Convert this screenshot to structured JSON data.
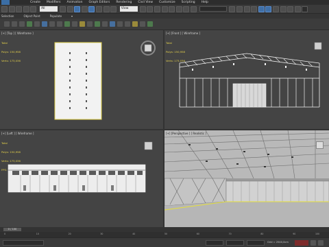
{
  "menu": {
    "items": [
      "Create",
      "Modifiers",
      "Animation",
      "Graph Editors",
      "Rendering",
      "Civil View",
      "Customize",
      "Scripting",
      "Help"
    ]
  },
  "toolbar": {
    "filter_value": "All",
    "view_value": "View"
  },
  "ribbon": {
    "tabs": [
      "Selection",
      "Object Paint",
      "Populate"
    ]
  },
  "viewports": {
    "top": {
      "label": "[+] [Top ] [ Wireframe ]",
      "stats_total": "Total",
      "stats_polys": "Polys: 150,958",
      "stats_verts": "Verts: 173,036"
    },
    "front": {
      "label": "[+] [Front ] [ Wireframe ]",
      "stats_total": "Total",
      "stats_polys": "Polys: 150,958",
      "stats_verts": "Verts: 173,036"
    },
    "left": {
      "label": "[+] [Left ] [ Wireframe ]",
      "stats_total": "Total",
      "stats_polys": "Polys: 150,958",
      "stats_verts": "Verts: 173,036",
      "stats_fps": "FPS:"
    },
    "persp": {
      "label": "[+] [Perspective ] [ Realistic ]"
    }
  },
  "timeline": {
    "slider_label": "0 / 100",
    "tick_labels": [
      "0",
      "10",
      "20",
      "30",
      "40",
      "50",
      "60",
      "70",
      "80",
      "90",
      "100"
    ]
  },
  "status": {
    "grid_text": "Grid = 2540,0cm"
  },
  "colors": {
    "background": "#444444",
    "active_border": "#f0d23a",
    "stats_text": "#e6d24a",
    "toolbar_blue": "#3f6fa7"
  }
}
